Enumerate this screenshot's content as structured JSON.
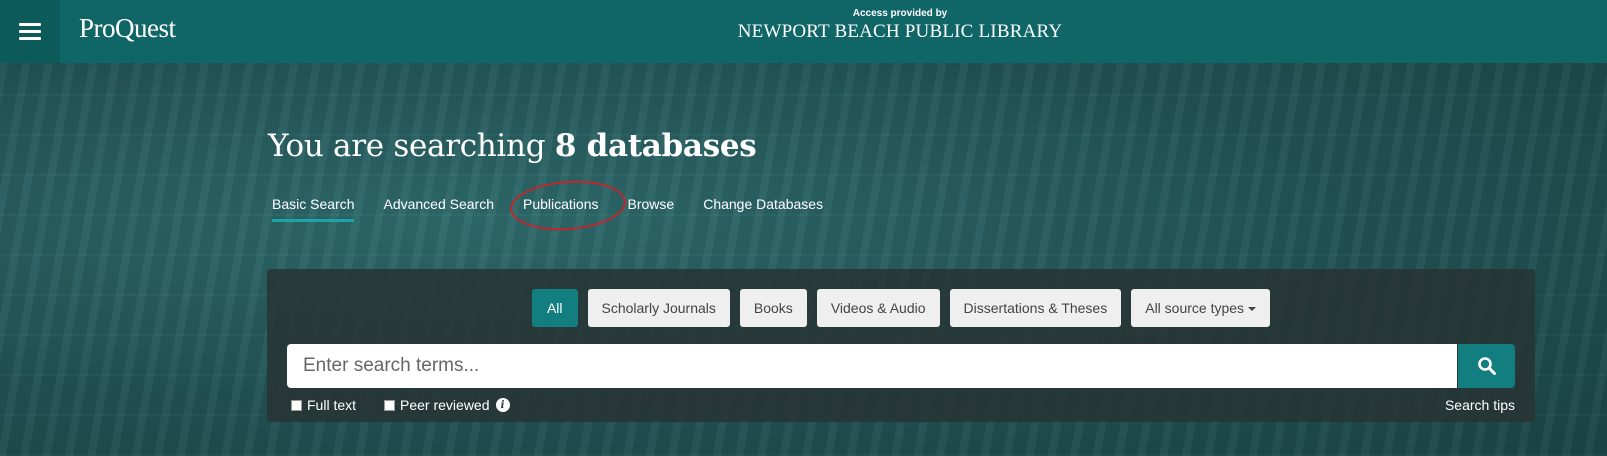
{
  "header": {
    "logo": "ProQuest",
    "access_label": "Access provided by",
    "library_name": "NEWPORT BEACH PUBLIC LIBRARY"
  },
  "hero": {
    "title_prefix": "You are searching",
    "title_count": "8 databases"
  },
  "nav": {
    "tabs": [
      {
        "label": "Basic Search"
      },
      {
        "label": "Advanced Search"
      },
      {
        "label": "Publications"
      },
      {
        "label": "Browse"
      },
      {
        "label": "Change Databases"
      }
    ],
    "active_tab": "Basic Search"
  },
  "source_types": {
    "buttons": [
      {
        "label": "All"
      },
      {
        "label": "Scholarly Journals"
      },
      {
        "label": "Books"
      },
      {
        "label": "Videos & Audio"
      },
      {
        "label": "Dissertations & Theses"
      },
      {
        "label": "All source types"
      }
    ],
    "selected": "All"
  },
  "search": {
    "placeholder": "Enter search terms...",
    "value": "",
    "icon": "search-icon"
  },
  "options": {
    "full_text": {
      "label": "Full text",
      "checked": false
    },
    "peer_reviewed": {
      "label": "Peer reviewed",
      "checked": false,
      "icon": "info-icon"
    },
    "search_tips": "Search tips"
  },
  "colors": {
    "header_bg": "#106667",
    "accent": "#127e80",
    "annotation": "#c1272d"
  }
}
